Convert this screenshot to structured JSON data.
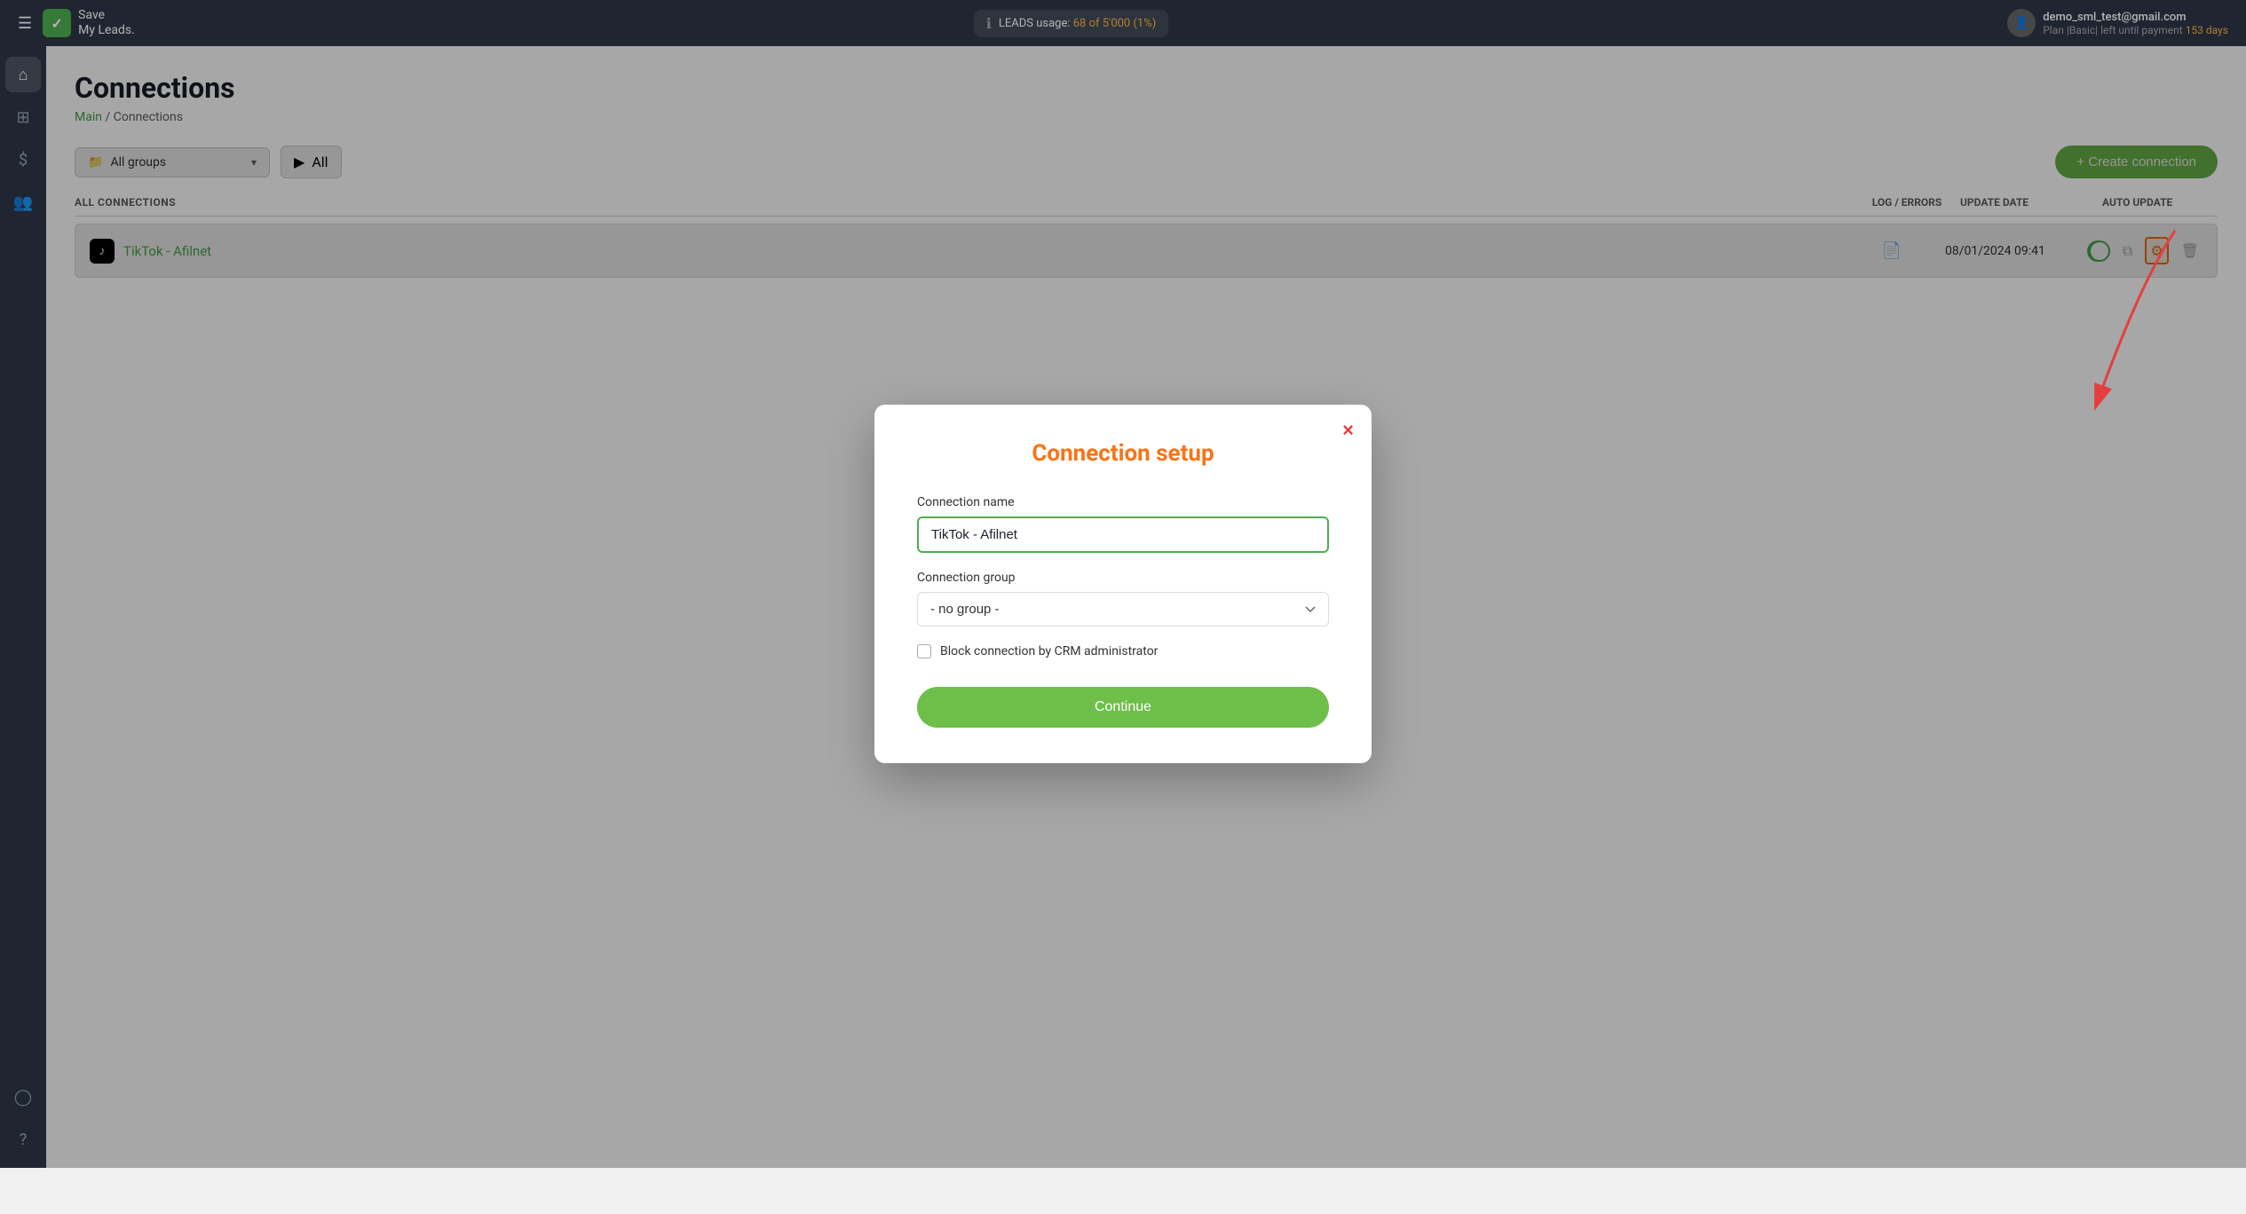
{
  "topbar": {
    "menu_label": "☰",
    "logo_text_line1": "Save",
    "logo_text_line2": "My Leads.",
    "leads_label": "LEADS usage:",
    "leads_count": "68 of 5'000 (1%)",
    "user_email": "demo_sml_test@gmail.com",
    "user_plan": "Plan |Basic| left until payment",
    "plan_days": "153 days"
  },
  "sidebar": {
    "items": [
      {
        "name": "home-icon",
        "icon": "⌂"
      },
      {
        "name": "connections-icon",
        "icon": "⊞"
      },
      {
        "name": "billing-icon",
        "icon": "$"
      },
      {
        "name": "team-icon",
        "icon": "👤"
      },
      {
        "name": "profile-icon",
        "icon": "◯"
      },
      {
        "name": "help-icon",
        "icon": "?"
      }
    ]
  },
  "page": {
    "title": "Connections",
    "breadcrumb_main": "Main",
    "breadcrumb_sep": " / ",
    "breadcrumb_current": "Connections"
  },
  "toolbar": {
    "group_label": "All groups",
    "status_label": "All ",
    "create_btn": "+ Create connection"
  },
  "table": {
    "col_all_connections": "ALL CONNECTIONS",
    "col_log_errors": "LOG / ERRORS",
    "col_update_date": "UPDATE DATE",
    "col_auto_update": "AUTO UPDATE",
    "rows": [
      {
        "name": "TikTok - Afilnet",
        "log_icon": "📄",
        "update_date": "08/01/2024 09:41",
        "auto_update": true
      }
    ]
  },
  "modal": {
    "title": "Connection setup",
    "close_label": "×",
    "connection_name_label": "Connection name",
    "connection_name_value": "TikTok - Afilnet",
    "connection_group_label": "Connection group",
    "connection_group_value": "- no group -",
    "group_options": [
      "- no group -"
    ],
    "block_checkbox_label": "Block connection by CRM administrator",
    "continue_btn": "Continue"
  },
  "colors": {
    "accent_green": "#6dbf4a",
    "accent_orange": "#f97316",
    "sidebar_bg": "#2d3748"
  }
}
